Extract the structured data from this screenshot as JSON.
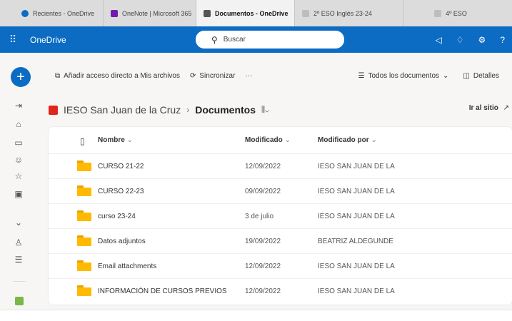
{
  "browser_tabs": [
    {
      "label": "Recientes - OneDrive",
      "color": "#0c6cc3"
    },
    {
      "label": "OneNote | Microsoft 365",
      "color": "#7719aa"
    },
    {
      "label": "Documentos - OneDrive",
      "color": "#555555"
    },
    {
      "label": "2º ESO Inglés 23-24",
      "color": "#bdbdbd"
    },
    {
      "label": "4º ESO",
      "color": "#bdbdbd"
    }
  ],
  "app": {
    "name": "OneDrive",
    "search_placeholder": "Buscar",
    "brand_color": "#0c6cc3"
  },
  "commands": {
    "add_shortcut": "Añadir acceso directo a Mis archivos",
    "sync": "Sincronizar",
    "more": "···",
    "view": "Todos los documentos",
    "details": "Detalles"
  },
  "breadcrumb": {
    "site": "IESO San Juan de la Cruz",
    "current": "Documentos",
    "go_to_site": "Ir al sitio"
  },
  "table": {
    "columns": {
      "name": "Nombre",
      "modified": "Modificado",
      "modified_by": "Modificado por"
    },
    "rows": [
      {
        "name": "CURSO 21-22",
        "modified": "12/09/2022",
        "modified_by": "IESO SAN JUAN DE LA"
      },
      {
        "name": "CURSO 22-23",
        "modified": "09/09/2022",
        "modified_by": "IESO SAN JUAN DE LA"
      },
      {
        "name": "curso 23-24",
        "modified": "3 de julio",
        "modified_by": "IESO SAN JUAN DE LA"
      },
      {
        "name": "Datos adjuntos",
        "modified": "19/09/2022",
        "modified_by": "BEATRIZ ALDEGUNDE"
      },
      {
        "name": "Email attachments",
        "modified": "12/09/2022",
        "modified_by": "IESO SAN JUAN DE LA"
      },
      {
        "name": "INFORMACIÓN DE CURSOS PREVIOS",
        "modified": "12/09/2022",
        "modified_by": "IESO SAN JUAN DE LA"
      }
    ]
  }
}
